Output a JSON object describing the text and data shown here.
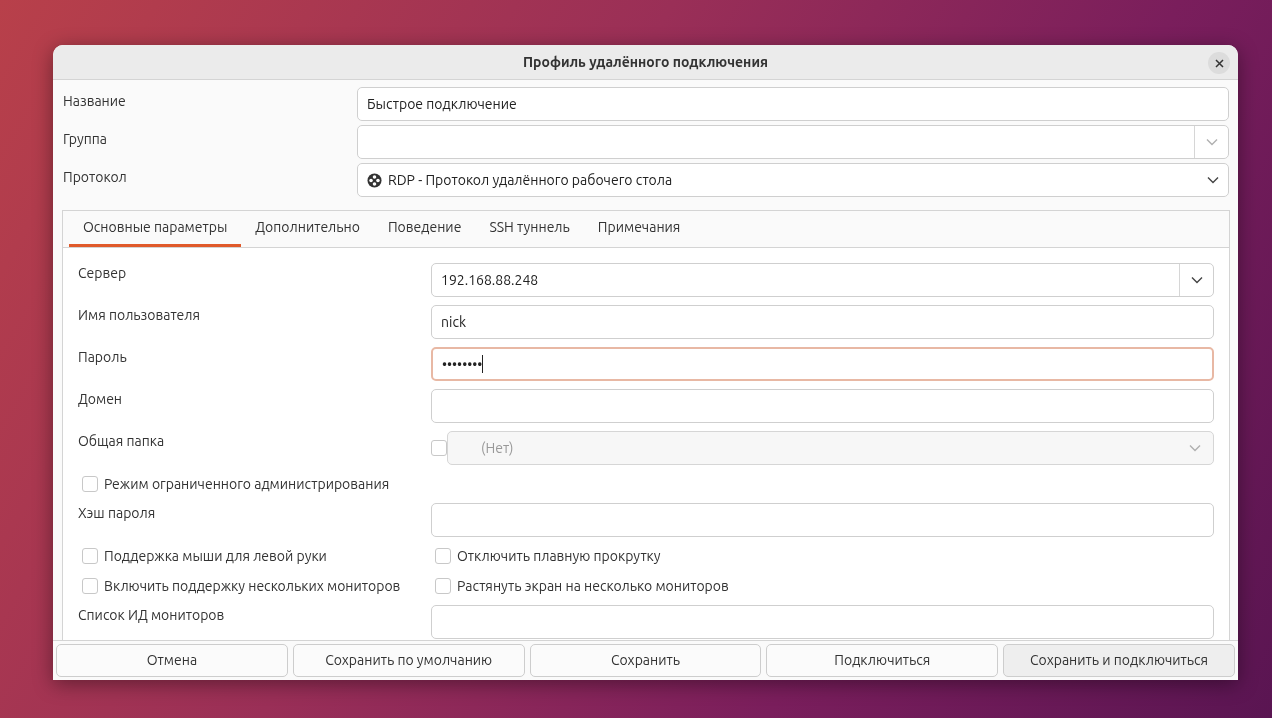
{
  "window": {
    "title": "Профиль удалённого подключения"
  },
  "top_fields": [
    {
      "kind": "entry",
      "label": "Название",
      "value": "Быстрое подключение"
    },
    {
      "kind": "combo_entry",
      "label": "Группа"
    },
    {
      "kind": "select",
      "label": "Протокол",
      "value": "RDP - Протокол удалённого рабочего стола"
    }
  ],
  "tabs": [
    {
      "label": "Основные параметры",
      "selected": true
    },
    {
      "label": "Дополнительно",
      "selected": false
    },
    {
      "label": "Поведение",
      "selected": false
    },
    {
      "label": "SSH туннель",
      "selected": false
    },
    {
      "label": "Примечания",
      "selected": false
    }
  ],
  "rows": [
    {
      "kind": "combo_entry",
      "label": "Сервер",
      "value": "192.168.88.248"
    },
    {
      "kind": "entry",
      "label": "Имя пользователя",
      "value": "nick"
    },
    {
      "kind": "entry",
      "label": "Пароль",
      "value": "••••••••",
      "focused": true
    },
    {
      "kind": "entry",
      "label": "Домен"
    },
    {
      "kind": "folder",
      "label": "Общая папка",
      "checked": false,
      "value": "(Нет)",
      "disabled": true
    },
    {
      "kind": "check",
      "checks": [
        {
          "label": "Режим ограниченного администрирования",
          "checked": false
        }
      ]
    },
    {
      "kind": "entry",
      "label": "Хэш пароля"
    },
    {
      "kind": "check",
      "checks": [
        {
          "label": "Поддержка мыши для левой руки",
          "checked": false
        },
        {
          "label": "Отключить плавную прокрутку",
          "checked": false
        }
      ]
    },
    {
      "kind": "check",
      "checks": [
        {
          "label": "Включить поддержку нескольких мониторов",
          "checked": false
        },
        {
          "label": "Растянуть экран на несколько мониторов",
          "checked": false
        }
      ]
    },
    {
      "kind": "entry",
      "label": "Список ИД мониторов"
    }
  ],
  "buttons": [
    {
      "label": "Отмена",
      "hovered": false
    },
    {
      "label": "Сохранить по умолчанию",
      "hovered": false
    },
    {
      "label": "Сохранить",
      "hovered": false
    },
    {
      "label": "Подключиться",
      "hovered": false
    },
    {
      "label": "Сохранить и подключиться",
      "hovered": true
    }
  ]
}
